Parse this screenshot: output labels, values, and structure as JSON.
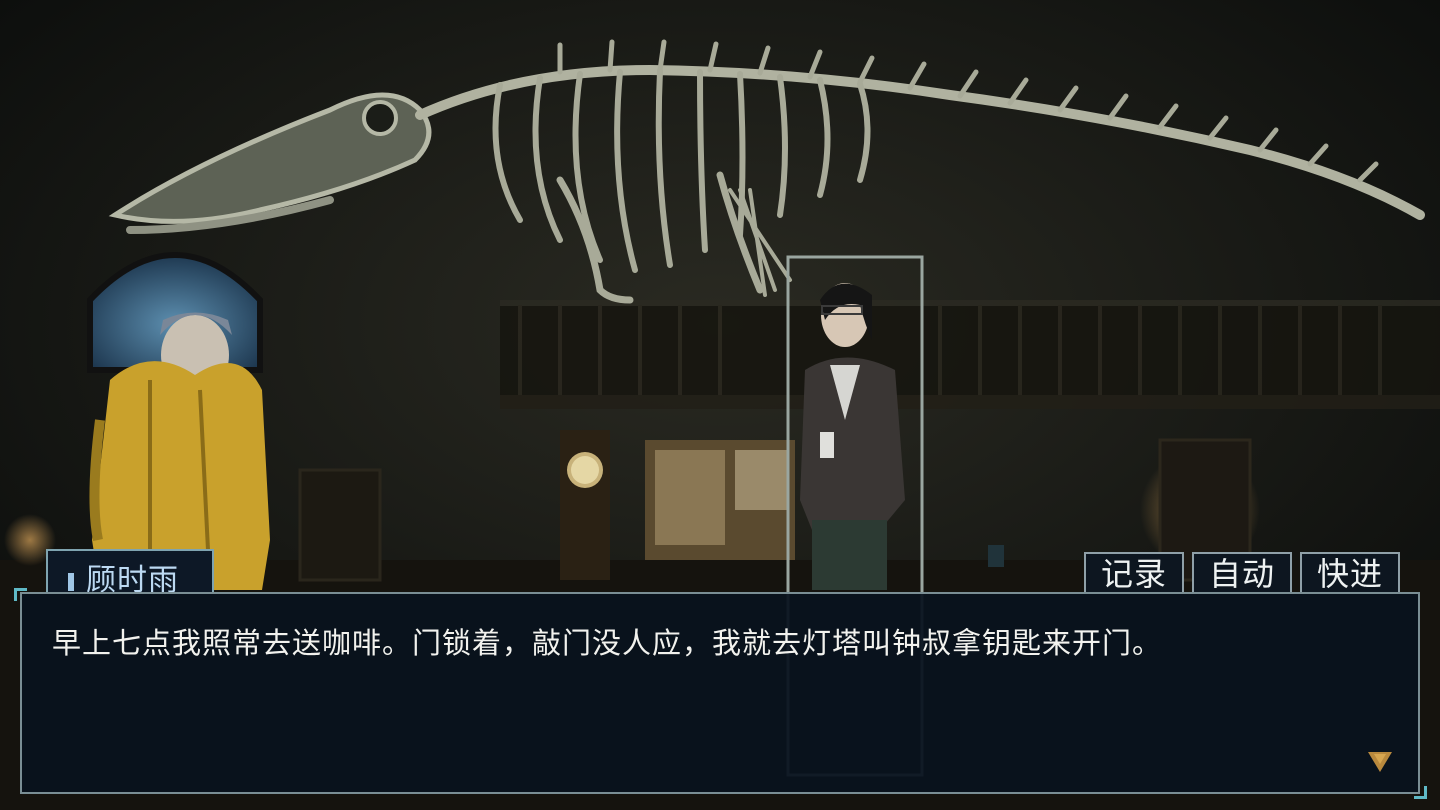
{
  "dialogue": {
    "speaker": "顾时雨",
    "text": "早上七点我照常去送咖啡。门锁着，敲门没人应，我就去灯塔叫钟叔拿钥匙来开门。"
  },
  "controls": {
    "log_label": "记录",
    "auto_label": "自动",
    "fast_label": "快进"
  },
  "icons": {
    "advance": "triangle-down-icon"
  },
  "colors": {
    "dialogue_bg": "#08121e",
    "border": "#7a8e94",
    "accent": "#5fb9c6",
    "speaker_text": "#bcd9f2",
    "advance_arrow": "#b9893d",
    "raincoat": "#c9a12c"
  }
}
